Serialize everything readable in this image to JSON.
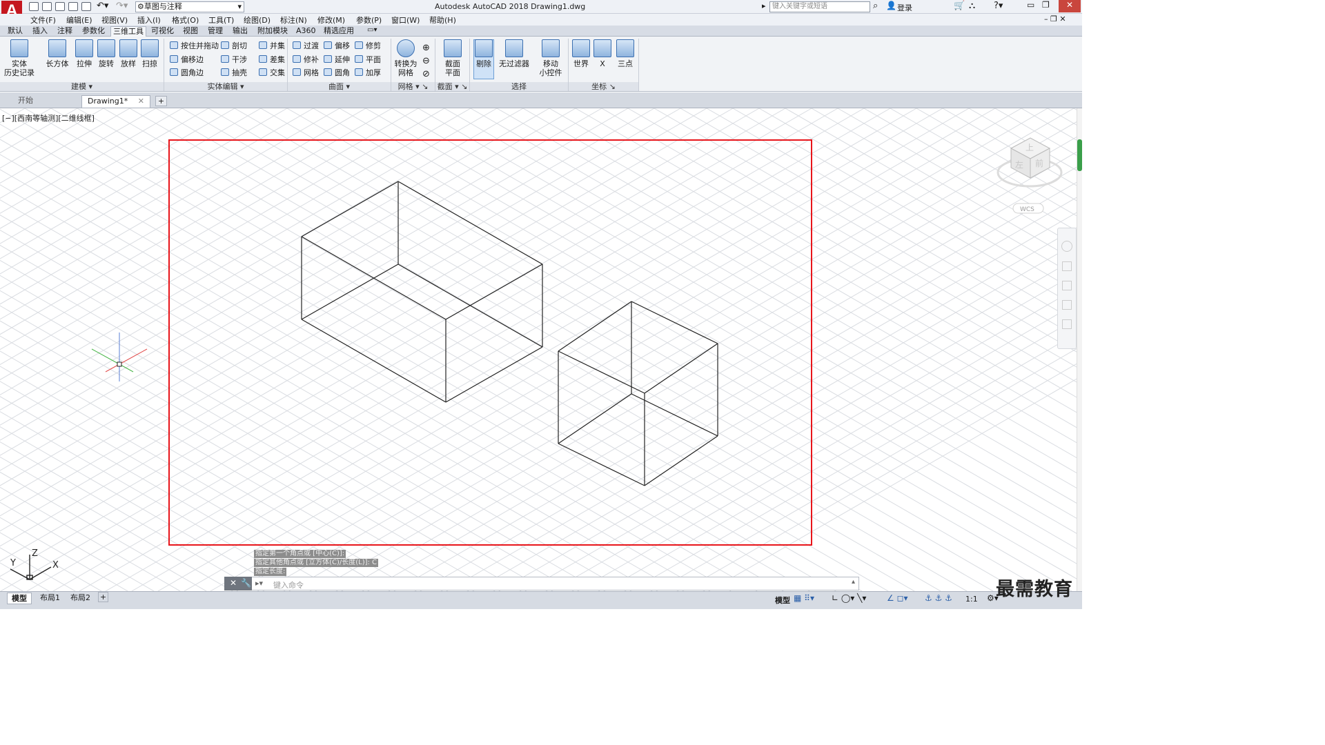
{
  "window": {
    "title": "Autodesk AutoCAD 2018    Drawing1.dwg",
    "app_letter": "A",
    "workspace": "草图与注释",
    "search_placeholder": "键入关键字或短语",
    "login": "登录"
  },
  "menus": [
    "文件(F)",
    "编辑(E)",
    "视图(V)",
    "插入(I)",
    "格式(O)",
    "工具(T)",
    "绘图(D)",
    "标注(N)",
    "修改(M)",
    "参数(P)",
    "窗口(W)",
    "帮助(H)"
  ],
  "ribbon_tabs": [
    "默认",
    "插入",
    "注释",
    "参数化",
    "三维工具",
    "可视化",
    "视图",
    "管理",
    "输出",
    "附加模块",
    "A360",
    "精选应用"
  ],
  "ribbon": {
    "history": [
      "实体",
      "历史记录"
    ],
    "modeling": [
      "长方体",
      "拉伸",
      "旋转",
      "放样",
      "扫掠"
    ],
    "solid_edit_col1": [
      "按住并拖动",
      "偏移边",
      "圆角边"
    ],
    "solid_edit_col2": [
      "剖切",
      "干涉",
      "抽壳"
    ],
    "solid_edit_col3": [
      "并集",
      "差集",
      "交集"
    ],
    "surface_col1": [
      "过渡",
      "修补",
      "网格"
    ],
    "surface_col2": [
      "偏移",
      "延伸",
      "圆角"
    ],
    "surface_col3": [
      "修剪",
      "平面",
      "加厚"
    ],
    "mesh_btn": [
      "转换为",
      "网格"
    ],
    "section_btn": [
      "截面",
      "平面"
    ],
    "select_delete": "剔除",
    "select_filter": "无过滤器",
    "gizmo": [
      "移动",
      "小控件"
    ],
    "ucs": [
      "世界",
      "X",
      "三点"
    ],
    "panel_titles": [
      "建模",
      "实体编辑",
      "曲面",
      "网格",
      "截面",
      "选择",
      "坐标"
    ]
  },
  "doc_tabs": [
    "开始",
    "Drawing1*"
  ],
  "viewport_label": "[−][西南等轴测][二维线框]",
  "viewcube": {
    "top": "上",
    "front": "前",
    "left": "左",
    "wcs": "WCS"
  },
  "axis": {
    "x": "X",
    "y": "Y",
    "z": "Z"
  },
  "command_history": [
    "指定第一个角点或 [中心(C)]:",
    "指定其他角点或 [立方体(C)/长度(L)]: C",
    "指定长度:"
  ],
  "command_placeholder": "键入命令",
  "layout_tabs": [
    "模型",
    "布局1",
    "布局2"
  ],
  "status": {
    "model": "模型",
    "scale": "1:1"
  },
  "watermark": "最需教育",
  "colors": {
    "highlight": "#e8141a",
    "accent": "#3b6fb0",
    "grid": "#d9dce1"
  }
}
